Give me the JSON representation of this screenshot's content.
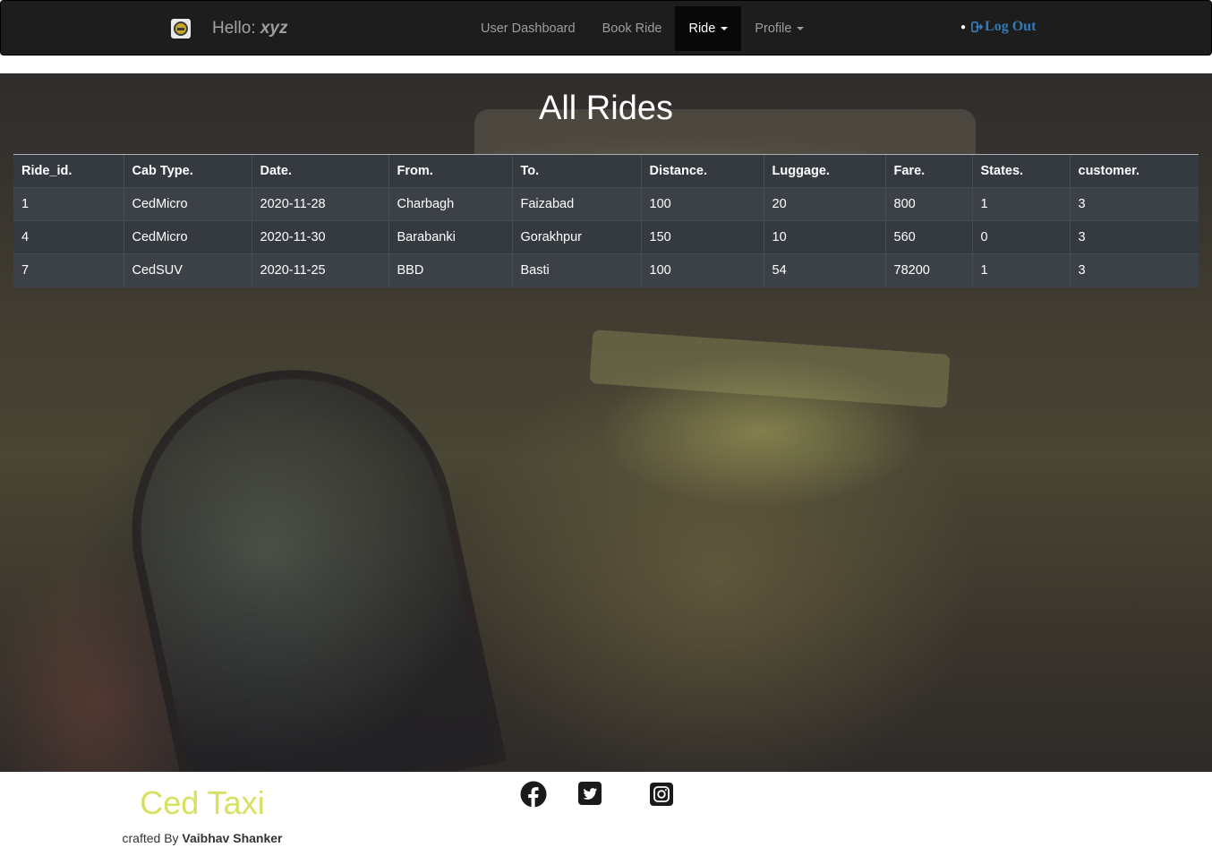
{
  "navbar": {
    "greeting_label": "Hello:",
    "username": "xyz",
    "links": [
      {
        "label": "User Dashboard"
      },
      {
        "label": "Book Ride"
      },
      {
        "label": "Ride"
      },
      {
        "label": "Profile"
      }
    ],
    "active_link": "Ride",
    "logout_label": "Log Out",
    "logout_icon": "sign-out-icon",
    "logo_icon": "taxi-logo-icon"
  },
  "page": {
    "title": "All Rides"
  },
  "table": {
    "columns": [
      "Ride_id.",
      "Cab Type.",
      "Date.",
      "From.",
      "To.",
      "Distance.",
      "Luggage.",
      "Fare.",
      "States.",
      "customer."
    ],
    "rows": [
      [
        "1",
        "CedMicro",
        "2020-11-28",
        "Charbagh",
        "Faizabad",
        "100",
        "20",
        "800",
        "1",
        "3"
      ],
      [
        "4",
        "CedMicro",
        "2020-11-30",
        "Barabanki",
        "Gorakhpur",
        "150",
        "10",
        "560",
        "0",
        "3"
      ],
      [
        "7",
        "CedSUV",
        "2020-11-25",
        "BBD",
        "Basti",
        "100",
        "54",
        "78200",
        "1",
        "3"
      ]
    ]
  },
  "footer": {
    "brand": "Ced Taxi",
    "credit_prefix": "crafted By",
    "credit_name": "Vaibhav Shanker",
    "social": [
      "facebook-icon",
      "twitter-icon",
      "instagram-icon"
    ]
  },
  "colors": {
    "navbar_bg": "#1d1d1d",
    "active_link_bg": "#080808",
    "logout_link": "#337ab7",
    "table_bg": "#343a40",
    "brand_color": "#d8e060"
  }
}
